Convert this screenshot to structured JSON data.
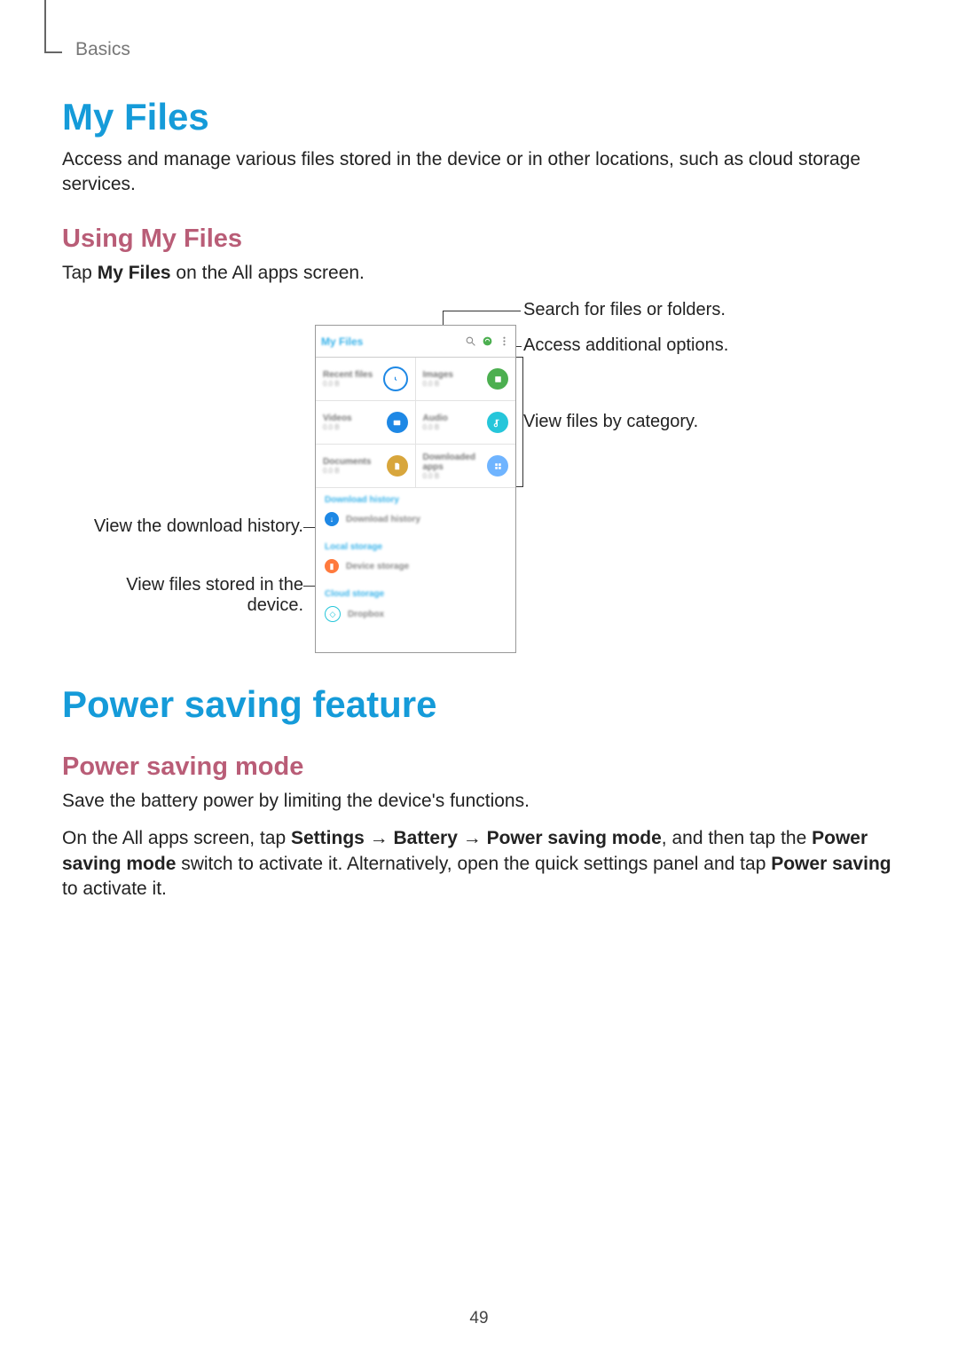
{
  "breadcrumb": "Basics",
  "page_number": "49",
  "sec1": {
    "h": "My Files",
    "p": "Access and manage various files stored in the device or in other locations, such as cloud storage services.",
    "sub": "Using My Files",
    "tap_pre": "Tap ",
    "tap_b": "My Files",
    "tap_post": " on the All apps screen."
  },
  "fig": {
    "title": "My Files",
    "tiles": [
      {
        "name": "Recent files",
        "sub": "0.0 B"
      },
      {
        "name": "Images",
        "sub": "0.0 B"
      },
      {
        "name": "Videos",
        "sub": "0.0 B"
      },
      {
        "name": "Audio",
        "sub": "0.0 B"
      },
      {
        "name": "Documents",
        "sub": "0.0 B"
      },
      {
        "name": "Downloaded apps",
        "sub": "0.0 B"
      }
    ],
    "sections": [
      {
        "header": "Download history",
        "row": "Download history"
      },
      {
        "header": "Local storage",
        "row": "Device storage"
      },
      {
        "header": "Cloud storage",
        "row": "Dropbox"
      }
    ],
    "callouts": {
      "search": "Search for files or folders.",
      "options": "Access additional options.",
      "category": "View files by category.",
      "downloads": "View the download history.",
      "device": "View files stored in the device."
    }
  },
  "sec2": {
    "h": "Power saving feature",
    "sub": "Power saving mode",
    "p1": "Save the battery power by limiting the device's functions.",
    "p2a": "On the All apps screen, tap ",
    "b_settings": "Settings",
    "arrow": " → ",
    "b_battery": "Battery",
    "b_psm": "Power saving mode",
    "p2b": ", and then tap the ",
    "b_psm2": "Power saving mode",
    "p2c": " switch to activate it. Alternatively, open the quick settings panel and tap ",
    "b_ps": "Power saving",
    "p2d": " to activate it."
  }
}
